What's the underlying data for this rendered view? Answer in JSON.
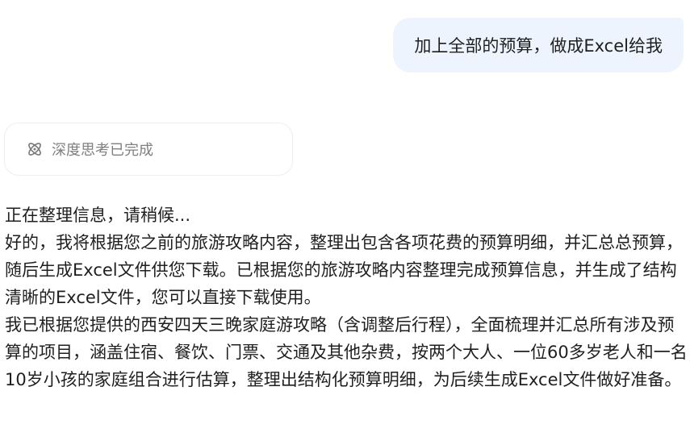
{
  "user_message": {
    "text": "加上全部的预算，做成Excel给我"
  },
  "thinking": {
    "label": "深度思考已完成",
    "icon": "atom-icon"
  },
  "assistant": {
    "paragraphs": [
      "正在整理信息，请稍候...",
      "好的，我将根据您之前的旅游攻略内容，整理出包含各项花费的预算明细，并汇总总预算，随后生成Excel文件供您下载。已根据您的旅游攻略内容整理完成预算信息，并生成了结构清晰的Excel文件，您可以直接下载使用。",
      "我已根据您提供的西安四天三晚家庭游攻略（含调整后行程），全面梳理并汇总所有涉及预算的项目，涵盖住宿、餐饮、门票、交通及其他杂费，按两个大人、一位60多岁老人和一名10岁小孩的家庭组合进行估算，整理出结构化预算明细，为后续生成Excel文件做好准备。"
    ]
  }
}
